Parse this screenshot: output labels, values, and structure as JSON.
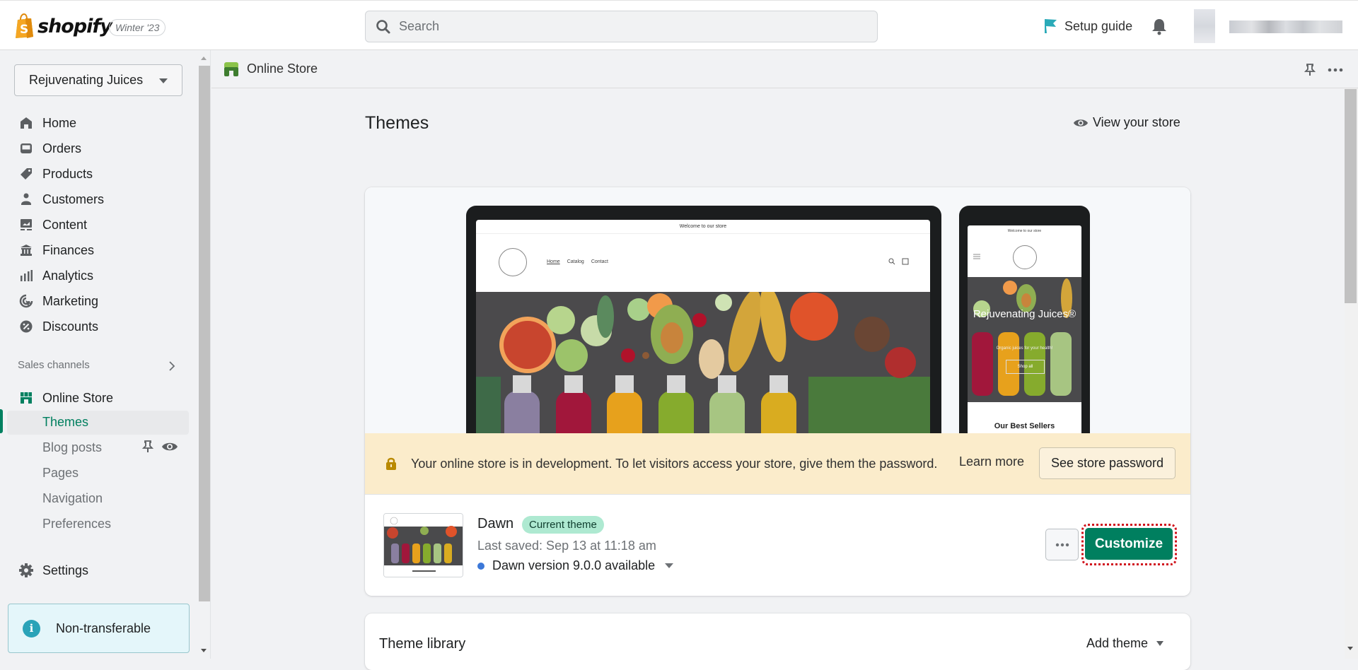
{
  "topbar": {
    "brand": "shopify",
    "release_badge": "Winter '23",
    "search_placeholder": "Search",
    "setup_guide": "Setup guide",
    "colors": {
      "flag": "#47c1bf"
    }
  },
  "sidebar": {
    "store_name": "Rejuvenating Juices",
    "items": [
      {
        "label": "Home",
        "icon": "home-icon"
      },
      {
        "label": "Orders",
        "icon": "orders-icon"
      },
      {
        "label": "Products",
        "icon": "tag-icon"
      },
      {
        "label": "Customers",
        "icon": "person-icon"
      },
      {
        "label": "Content",
        "icon": "content-icon"
      },
      {
        "label": "Finances",
        "icon": "bank-icon"
      },
      {
        "label": "Analytics",
        "icon": "bar-chart-icon"
      },
      {
        "label": "Marketing",
        "icon": "target-icon"
      },
      {
        "label": "Discounts",
        "icon": "discount-icon"
      }
    ],
    "sales_channels_label": "Sales channels",
    "online_store": {
      "label": "Online Store",
      "subitems": [
        "Themes",
        "Blog posts",
        "Pages",
        "Navigation",
        "Preferences"
      ],
      "active": "Themes"
    },
    "settings": "Settings",
    "notice": "Non-transferable"
  },
  "channel_header": {
    "title": "Online Store"
  },
  "main": {
    "title": "Themes",
    "view_store": "View your store",
    "preview": {
      "announcement": "Welcome to our store",
      "nav": [
        "Home",
        "Catalog",
        "Contact"
      ],
      "hero_title": "Rejuvenating Juices®",
      "hero_subtitle": "Organic juices for your health!",
      "hero_button": "Shop all",
      "best_sellers": "Our Best Sellers"
    },
    "banner": {
      "message": "Your online store is in development. To let visitors access your store, give them the password.",
      "learn_more": "Learn more",
      "button": "See store password"
    },
    "current_theme": {
      "name": "Dawn",
      "badge": "Current theme",
      "last_saved": "Last saved: Sep 13 at 11:18 am",
      "version": "Dawn version 9.0.0 available",
      "customize": "Customize"
    },
    "library": {
      "title": "Theme library",
      "add_theme": "Add theme"
    }
  },
  "colors": {
    "accent": "#008060",
    "primary_button": "#007f5f",
    "badge_bg": "#aee9d1",
    "banner_bg": "#fbeccb",
    "info_bg": "#e4f6fa"
  }
}
